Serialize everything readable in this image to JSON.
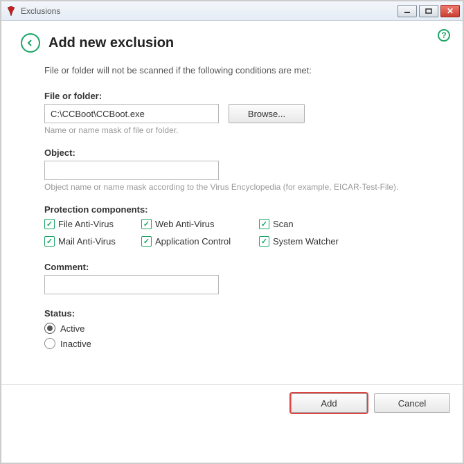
{
  "window": {
    "title": "Exclusions"
  },
  "page": {
    "heading": "Add new exclusion",
    "description": "File or folder will not be scanned if the following conditions are met:"
  },
  "file": {
    "label": "File or folder:",
    "value": "C:\\CCBoot\\CCBoot.exe",
    "browse": "Browse...",
    "hint": "Name or name mask of file or folder."
  },
  "object": {
    "label": "Object:",
    "value": "",
    "hint": "Object name or name mask according to the Virus Encyclopedia (for example, EICAR-Test-File)."
  },
  "components": {
    "label": "Protection components:",
    "items": [
      "File Anti-Virus",
      "Web Anti-Virus",
      "Scan",
      "Mail Anti-Virus",
      "Application Control",
      "System Watcher"
    ]
  },
  "comment": {
    "label": "Comment:",
    "value": ""
  },
  "status": {
    "label": "Status:",
    "active": "Active",
    "inactive": "Inactive",
    "selected": "active"
  },
  "buttons": {
    "add": "Add",
    "cancel": "Cancel"
  },
  "help": "?"
}
